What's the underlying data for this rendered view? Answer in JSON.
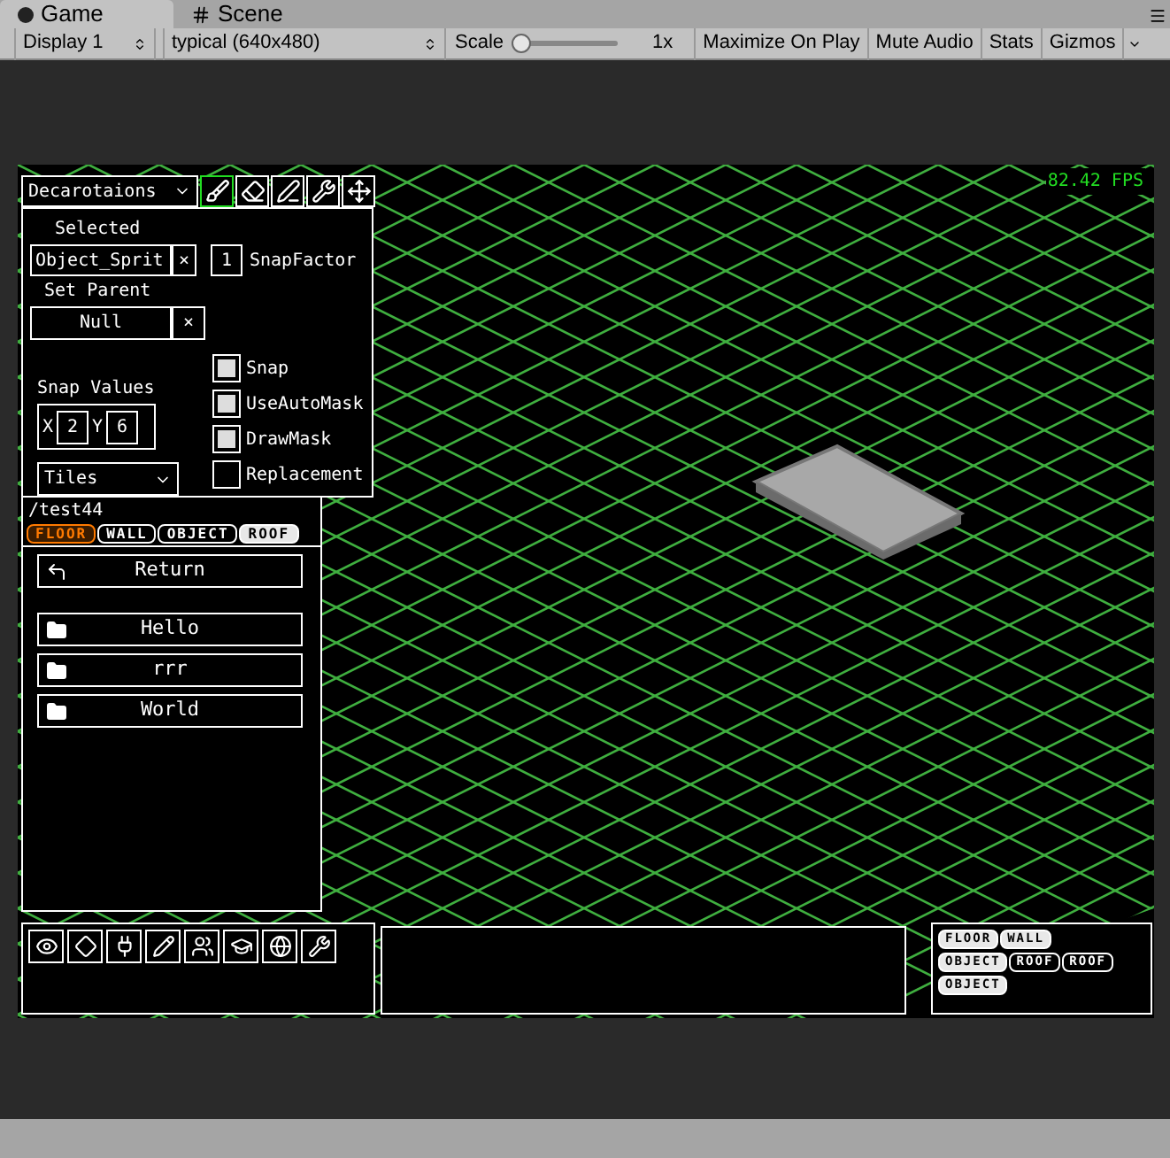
{
  "tabs": [
    {
      "label": "Game",
      "selected": true,
      "kind": "game"
    },
    {
      "label": "Scene",
      "selected": false,
      "kind": "scene"
    }
  ],
  "toolbar": {
    "display": "Display 1",
    "resolution": "typical (640x480)",
    "scale_label": "Scale",
    "scale": {
      "level": 0.0
    },
    "scale_value": "1x",
    "buttons": [
      "Maximize On Play",
      "Mute Audio",
      "Stats",
      "Gizmos"
    ]
  },
  "game": {
    "fps": "82.42 FPS",
    "editor": {
      "mode": "Decarotaions",
      "tools": [
        {
          "kind": "brush",
          "selected": true
        },
        {
          "kind": "eraser",
          "selected": false
        },
        {
          "kind": "pen",
          "selected": false
        },
        {
          "kind": "wrench",
          "selected": false
        },
        {
          "kind": "move",
          "selected": false
        }
      ],
      "selected_label": "Selected",
      "selected_value": "Object_Sprit",
      "clear": "×",
      "snap_factor": "1",
      "snap_factor_label": "SnapFactor",
      "parent_label": "Set Parent",
      "parent_value": "Null",
      "parent_clear": "×",
      "snap_values_label": "Snap Values",
      "x_label": "X",
      "x_value": "2",
      "y_label": "Y",
      "y_value": "6",
      "checkboxes": [
        {
          "label": "Snap",
          "checked": true
        },
        {
          "label": "UseAutoMask",
          "checked": true
        },
        {
          "label": "DrawMask",
          "checked": true
        },
        {
          "label": "Replacement",
          "checked": false
        }
      ],
      "category": "Tiles",
      "path": "/test44",
      "layer_tabs": [
        {
          "label": "FLOOR",
          "selected": true,
          "filled": false
        },
        {
          "label": "WALL",
          "selected": false,
          "filled": false
        },
        {
          "label": "OBJECT",
          "selected": false,
          "filled": false
        },
        {
          "label": "ROOF",
          "selected": false,
          "filled": true
        }
      ],
      "items": [
        {
          "kind": "return",
          "label": "Return"
        },
        {
          "kind": "folder",
          "label": "Hello"
        },
        {
          "kind": "folder",
          "label": "rrr"
        },
        {
          "kind": "folder",
          "label": "World"
        }
      ]
    },
    "bottom_tools": [
      {
        "kind": "eye"
      },
      {
        "kind": "diamond"
      },
      {
        "kind": "plug"
      },
      {
        "kind": "pencil"
      },
      {
        "kind": "users"
      },
      {
        "kind": "cap"
      },
      {
        "kind": "globe"
      },
      {
        "kind": "wrench"
      }
    ],
    "layer_tags": [
      [
        {
          "label": "FLOOR",
          "filled": true
        },
        {
          "label": "WALL",
          "filled": true
        }
      ],
      [
        {
          "label": "OBJECT",
          "filled": true
        },
        {
          "label": "ROOF",
          "filled": false
        },
        {
          "label": "ROOF",
          "filled": false
        }
      ],
      [
        {
          "label": "OBJECT",
          "filled": true
        }
      ]
    ]
  }
}
